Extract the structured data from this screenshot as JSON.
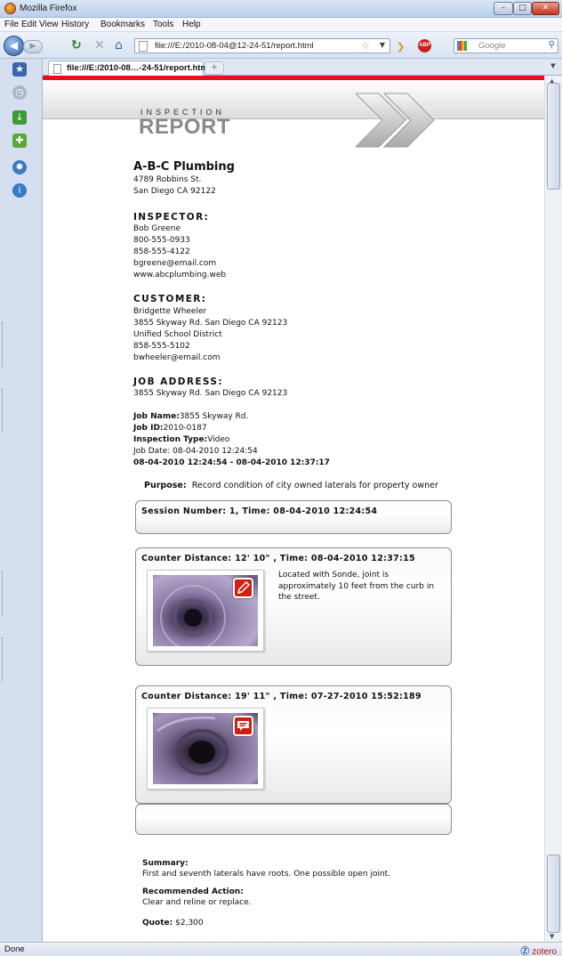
{
  "window": {
    "title": "Mozilla Firefox",
    "buttons": {
      "minimize": "–",
      "maximize": "□",
      "close": "✕"
    }
  },
  "menu": [
    "File",
    "Edit",
    "View",
    "History",
    "Bookmarks",
    "Tools",
    "Help"
  ],
  "navbar": {
    "url": "file:///E:/2010-08-04@12-24-51/report.html",
    "search_placeholder": "Google",
    "abp_label": "ABP"
  },
  "tab": {
    "label": "file:///E:/2010-08…-24-51/report.html",
    "new_tab": "+"
  },
  "report": {
    "header": {
      "small": "INSPECTION",
      "big": "REPORT"
    },
    "company": {
      "name": "A-B-C Plumbing",
      "address1": "4789 Robbins St.",
      "address2": "San Diego CA 92122"
    },
    "inspector": {
      "heading": "INSPECTOR:",
      "name": "Bob Greene",
      "phone1": "800-555-0933",
      "phone2": "858-555-4122",
      "email": "bgreene@email.com",
      "web": "www.abcplumbing.web"
    },
    "customer": {
      "heading": "CUSTOMER:",
      "name": "Bridgette Wheeler",
      "address": "3855 Skyway Rd. San Diego CA 92123",
      "org": "Unified School District",
      "phone": "858-555-5102",
      "email": "bwheeler@email.com"
    },
    "job_address": {
      "heading": "JOB ADDRESS:",
      "address": "3855 Skyway Rd. San Diego CA 92123"
    },
    "job": {
      "name_label": "Job Name:",
      "name_value": "3855 Skyway Rd.",
      "id_label": "Job ID:",
      "id_value": "2010-0187",
      "type_label": "Inspection Type:",
      "type_value": "Video",
      "date_line": "Job Date: 08-04-2010 12:24:54",
      "range_line": "08-04-2010 12:24:54 - 08-04-2010 12:37:17"
    },
    "purpose": {
      "label": "Purpose:",
      "value": "Record condition of city owned laterals for property owner"
    },
    "session": {
      "head": "Session Number: 1, Time: 08-04-2010 12:24:54"
    },
    "observations": [
      {
        "head": "Counter Distance: 12' 10\" , Time: 08-04-2010 12:37:15",
        "text": "Located with Sonde, joint is approximately 10 feet from the curb in the street."
      },
      {
        "head": "Counter Distance: 19' 11\" , Time: 07-27-2010 15:52:189",
        "text": ""
      }
    ],
    "summary": {
      "label": "Summary:",
      "value": "First and seventh laterals have roots. One possible open joint.",
      "action_label": "Recommended Action:",
      "action_value": "Clear and reline or replace.",
      "quote_label": "Quote:",
      "quote_value": "$2,300"
    }
  },
  "status": {
    "text": "Done",
    "zotero": "zotero"
  },
  "icons": {
    "back": "back-arrow-icon",
    "forward": "forward-arrow-icon",
    "reload": "reload-icon",
    "stop": "stop-icon",
    "home": "home-icon",
    "bookmark": "star-icon",
    "note": "pencil-note-icon",
    "comment": "speech-bubble-icon"
  },
  "colors": {
    "accent_red": "#e4101a",
    "badge_red": "#d21e12",
    "link_blue": "#3a66a8"
  }
}
